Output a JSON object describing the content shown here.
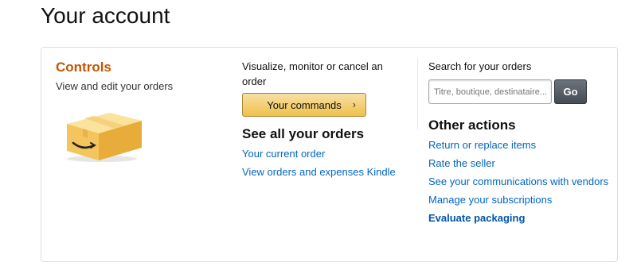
{
  "page": {
    "title": "Your account"
  },
  "controls": {
    "title": "Controls",
    "subtitle": "View and edit your orders"
  },
  "orders": {
    "lead": "Visualize, monitor or cancel an order",
    "commands_button": "Your commands",
    "chevron": "›",
    "heading": "See all your orders",
    "links": [
      "Your current order",
      "View orders and expenses Kindle"
    ]
  },
  "search": {
    "label": "Search for your orders",
    "placeholder": "Titre, boutique, destinataire...",
    "go": "Go"
  },
  "other": {
    "heading": "Other actions",
    "links": [
      "Return or replace items",
      "Rate the seller",
      "See your communications with vendors",
      "Manage your subscriptions",
      "Evaluate packaging"
    ]
  },
  "colors": {
    "accent": "#c45500",
    "link": "#0066c0",
    "button_gold": "#f0c14b",
    "go_button": "#454c54"
  }
}
